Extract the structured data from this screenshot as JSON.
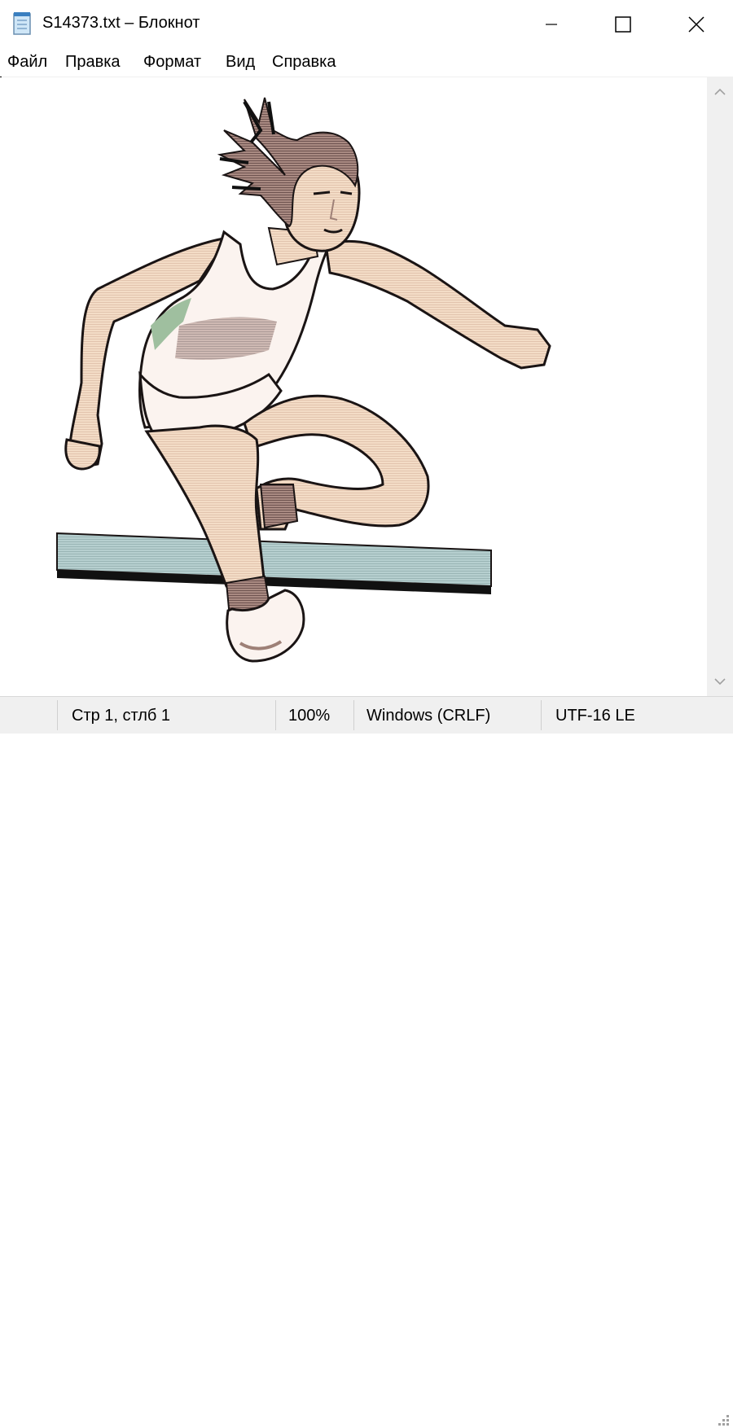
{
  "window": {
    "title": "S14373.txt – Блокнот"
  },
  "menu": {
    "items": [
      "Файл",
      "Правка",
      "Формат",
      "Вид",
      "Справка"
    ]
  },
  "editor": {
    "content_description_icon": "hurdler-ascii-art-image"
  },
  "status": {
    "position": "Стр 1, стлб 1",
    "zoom": "100%",
    "line_endings": "Windows (CRLF)",
    "encoding": "UTF-16 LE"
  },
  "colors": {
    "skin": "#f3dcc6",
    "skin_shadow": "#9e8077",
    "outline": "#1a1414",
    "hurdle": "#b6cfcf",
    "shirt_accent": "#9fbf9f",
    "scrollbar": "#f0f0f0",
    "statusbar": "#f0f0f0"
  }
}
